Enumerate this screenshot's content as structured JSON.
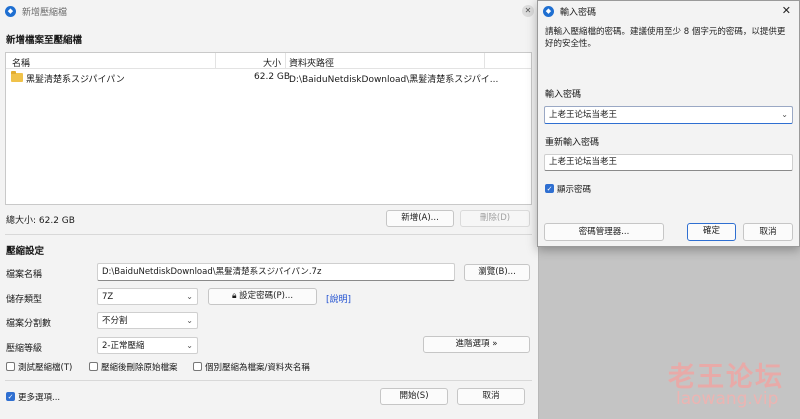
{
  "main_window": {
    "title": "新增壓縮檔",
    "section_title": "新增檔案至壓縮檔",
    "columns": {
      "name": "名稱",
      "size": "大小",
      "path": "資料夾路徑"
    },
    "files": [
      {
        "name": "黑髮清楚系スジパイパン",
        "size": "62.2 GB",
        "path": "D:\\BaiduNetdiskDownload\\黑髮清楚系スジパイ..."
      }
    ],
    "total_size": "總大小: 62.2 GB",
    "add_button": "新增(A)...",
    "delete_button": "刪除(D)",
    "settings_title": "壓縮設定",
    "filename_label": "檔案名稱",
    "filename_value": "D:\\BaiduNetdiskDownload\\黑髮清楚系スジパイパン.7z",
    "browse_button": "瀏覽(B)...",
    "storage_type_label": "儲存類型",
    "storage_type_value": "7Z",
    "set_password_button": "設定密碼(P)...",
    "help_link": "[說明]",
    "split_label": "檔案分割數",
    "split_value": "不分割",
    "level_label": "壓縮等級",
    "level_value": "2-正常壓縮",
    "advanced_button": "進階選項 »",
    "test_checkbox": "測試壓縮檔(T)",
    "delete_after_checkbox": "壓縮後刪除原始檔案",
    "separate_checkbox": "個別壓縮為檔案/資料夾名稱",
    "more_options": "更多選項...",
    "start_button": "開始(S)",
    "cancel_button": "取消"
  },
  "password_dialog": {
    "title": "輸入密碼",
    "description": "請輸入壓縮檔的密碼。建議使用至少 8 個字元的密碼，以提供更好的安全性。",
    "password_label": "輸入密碼",
    "password_value": "上老王论坛当老王",
    "confirm_label": "重新輸入密碼",
    "confirm_value": "上老王论坛当老王",
    "show_password": "顯示密碼",
    "manager_button": "密碼管理器...",
    "ok_button": "確定",
    "cancel_button": "取消"
  },
  "watermark": {
    "text": "老王论坛",
    "url": "laowang.vip"
  },
  "colors": {
    "accent": "#2f6fd1",
    "folder": "#f0c24a"
  }
}
